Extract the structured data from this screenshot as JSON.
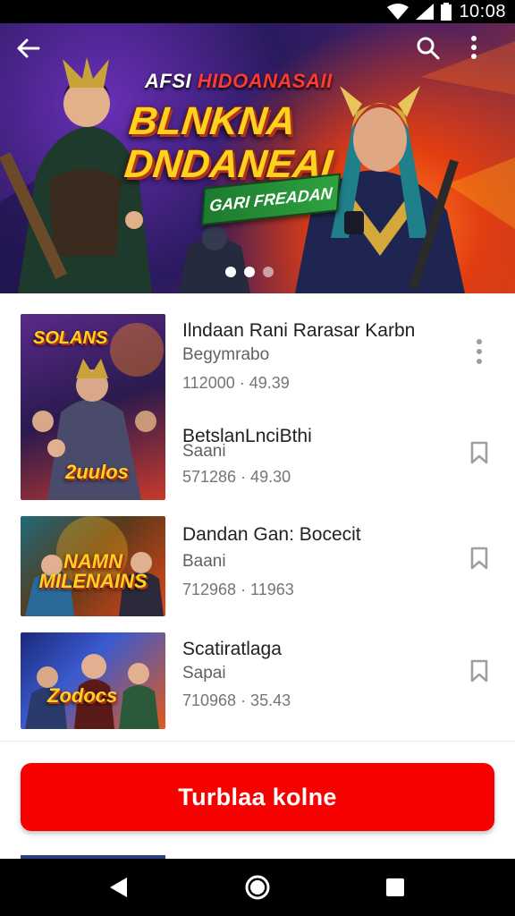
{
  "status_bar": {
    "time": "10:08"
  },
  "banner": {
    "supertitle_white": "AFSI ",
    "supertitle_red": "HIDOANASAII",
    "title": "BLNKNA DNDANEAI",
    "ribbon": "GARI FREADAN",
    "page_indicator": {
      "count": 3,
      "active": 1
    },
    "icons": {
      "back": "arrow-back-icon",
      "search": "search-icon",
      "more": "more-vertical-icon"
    }
  },
  "list": {
    "items": [
      {
        "title": "Ilndaan Rani Rarasar Karbn",
        "subtitle": "Begymrabo",
        "meta": "112000 · 49.39",
        "thumb_text": "SOLANS",
        "thumb_text2": "2uulos",
        "action_icon": "more-vertical-icon"
      },
      {
        "title": "BetslanLnciBthi",
        "subtitle": "Saani",
        "meta": "571286 · 49.30",
        "action_icon": "bookmark-icon"
      },
      {
        "title": "Dandan Gan: Bocecit",
        "subtitle": "Baani",
        "meta": "712968 · 11963",
        "thumb_text": "NAMN MILENAINS",
        "action_icon": "bookmark-icon"
      },
      {
        "title": "Scatiratlaga",
        "subtitle": "Sapai",
        "meta": "710968 · 35.43",
        "thumb_text": "Zodocs",
        "action_icon": "bookmark-icon"
      }
    ]
  },
  "cta": {
    "label": "Turblaa kolne"
  },
  "nav_bar": {
    "icons": [
      "back-triangle-icon",
      "home-circle-icon",
      "recents-square-icon"
    ]
  },
  "colors": {
    "cta": "#f60000",
    "text_primary": "#212121",
    "text_secondary": "#757575"
  }
}
